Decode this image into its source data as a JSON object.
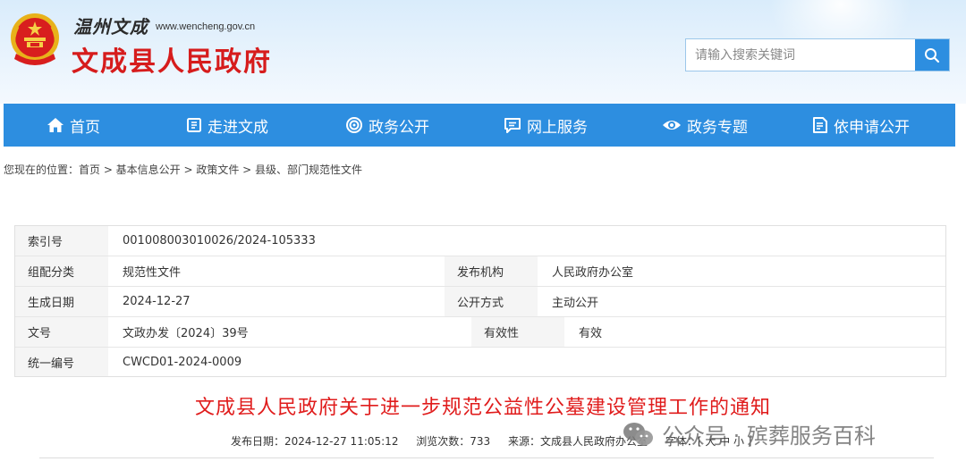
{
  "header": {
    "calligraphy": "温州文成",
    "domain": "www.wencheng.gov.cn",
    "site_title": "文成县人民政府",
    "search_placeholder": "请输入搜索关键词"
  },
  "nav": [
    {
      "label": "首页",
      "icon": "home-icon"
    },
    {
      "label": "走进文成",
      "icon": "book-icon"
    },
    {
      "label": "政务公开",
      "icon": "broadcast-icon"
    },
    {
      "label": "网上服务",
      "icon": "chat-icon"
    },
    {
      "label": "政务专题",
      "icon": "eye-icon"
    },
    {
      "label": "依申请公开",
      "icon": "document-icon"
    }
  ],
  "breadcrumb": "您现在的位置：首页 > 基本信息公开 > 政策文件 > 县级、部门规范性文件",
  "meta": {
    "index_label": "索引号",
    "index_value": "001008003010026/2024-105333",
    "category_label": "组配分类",
    "category_value": "规范性文件",
    "publisher_label": "发布机构",
    "publisher_value": "人民政府办公室",
    "date_label": "生成日期",
    "date_value": "2024-12-27",
    "open_label": "公开方式",
    "open_value": "主动公开",
    "docno_label": "文号",
    "docno_value": "文政办发〔2024〕39号",
    "validity_label": "有效性",
    "validity_value": "有效",
    "code_label": "统一编号",
    "code_value": "CWCD01-2024-0009"
  },
  "document": {
    "title": "文成县人民政府关于进一步规范公益性公墓建设管理工作的通知",
    "pub_date": "发布日期：2024-12-27 11:05:12",
    "views": "浏览次数：733",
    "source": "来源：文成县人民政府办公室",
    "font_size": "字体：[ 大 中 小 ]"
  },
  "watermark": "公众号 · 殡葬服务百科"
}
